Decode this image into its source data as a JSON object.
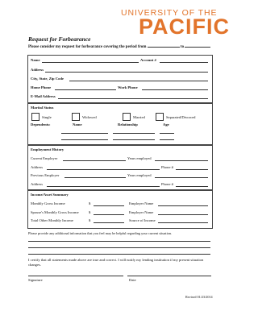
{
  "logo": {
    "line1": "UNIVERSITY OF THE",
    "line2": "PACIFIC"
  },
  "form": {
    "title": "Request for Forbearance",
    "intro": "Please consider my request for forbearance covering the period from",
    "intro_to": "to"
  },
  "personal": {
    "name": "Name",
    "account": "Account #",
    "address": "Address",
    "city": "City, State, Zip Code",
    "home_phone": "Home Phone",
    "work_phone": "Work Phone",
    "email": "E-Mail Address"
  },
  "marital": {
    "heading": "Marital Status",
    "options": [
      "Single",
      "Widowed",
      "Married",
      "Separated/Divorced"
    ],
    "dependents": "Dependents:",
    "col_name": "Name",
    "col_relationship": "Relationship",
    "col_age": "Age"
  },
  "employment": {
    "heading": "Employment History",
    "current": "Current Employer",
    "years1": "Years employed",
    "address1": "Address",
    "phone1": "Phone #",
    "previous": "Previous Employer",
    "years2": "Years employed",
    "address2": "Address",
    "phone2": "Phone #"
  },
  "income": {
    "heading": "Income/Asset Summary",
    "monthly_gross": "Monthly Gross Income",
    "dollar": "$",
    "employer_name": "Employer Name",
    "spouse_income": "Spouse's Monthly Gross Income",
    "employer_name2": "Employer Name",
    "total_other": "Total Other Monthly Income",
    "source": "Source of Income"
  },
  "additional": "Please provide any additional information that you feel may be helpful regarding your current situation.",
  "certify": "I certify that all statements made above are true and correct. I will notify my lending institution if my present situation changes.",
  "signature": "Signature",
  "date": "Date",
  "revised": "Revised 01/23/2014"
}
